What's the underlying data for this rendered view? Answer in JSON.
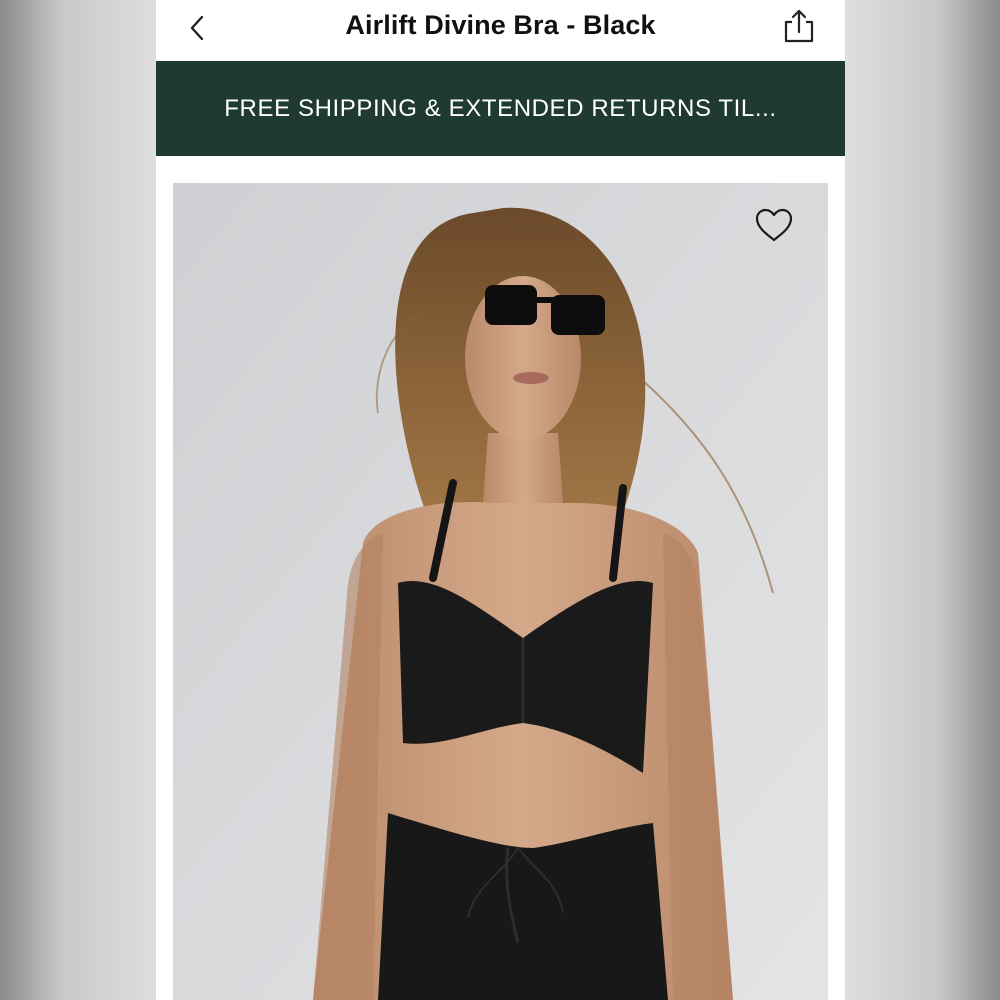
{
  "header": {
    "title": "Airlift Divine Bra - Black",
    "back_icon": "chevron-left-icon",
    "share_icon": "share-icon"
  },
  "promo": {
    "text": "FREE SHIPPING & EXTENDED RETURNS TIL...",
    "background": "#1f3a2e"
  },
  "product": {
    "image_alt": "Model wearing Airlift Divine Bra in black",
    "wishlist_icon": "heart-outline-icon"
  },
  "colors": {
    "banner": "#1f3a2e",
    "text": "#111111",
    "background": "#ffffff"
  }
}
